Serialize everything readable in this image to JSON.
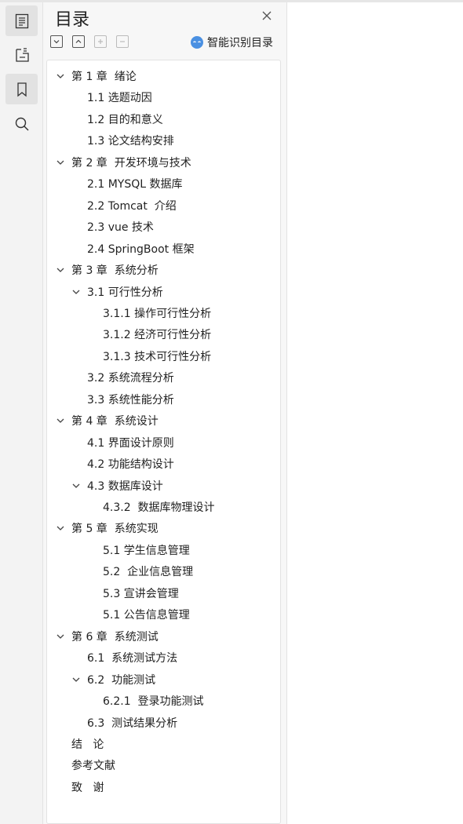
{
  "panel": {
    "title": "目录",
    "smart_label": "智能识别目录",
    "toolbar": [
      "collapse-all-icon",
      "expand-all-icon",
      "expand-level-icon",
      "collapse-level-icon"
    ]
  },
  "rail": [
    "toc-icon",
    "annotation-icon",
    "bookmark-icon",
    "search-icon"
  ],
  "toc": [
    {
      "text": "第 1 章  绪论",
      "level": 0,
      "expanded": true
    },
    {
      "text": "1.1 选题动因",
      "level": 1
    },
    {
      "text": "1.2 目的和意义",
      "level": 1
    },
    {
      "text": "1.3 论文结构安排",
      "level": 1
    },
    {
      "text": "第 2 章  开发环境与技术",
      "level": 0,
      "expanded": true
    },
    {
      "text": "2.1 MYSQL 数据库",
      "level": 1
    },
    {
      "text": "2.2 Tomcat  介绍",
      "level": 1
    },
    {
      "text": "2.3 vue 技术",
      "level": 1
    },
    {
      "text": "2.4 SpringBoot 框架",
      "level": 1
    },
    {
      "text": "第 3 章  系统分析",
      "level": 0,
      "expanded": true
    },
    {
      "text": "3.1 可行性分析",
      "level": 1,
      "expanded": true
    },
    {
      "text": "3.1.1 操作可行性分析",
      "level": 2
    },
    {
      "text": "3.1.2 经济可行性分析",
      "level": 2
    },
    {
      "text": "3.1.3 技术可行性分析",
      "level": 2
    },
    {
      "text": "3.2 系统流程分析",
      "level": 1
    },
    {
      "text": "3.3 系统性能分析",
      "level": 1
    },
    {
      "text": "第 4 章  系统设计",
      "level": 0,
      "expanded": true
    },
    {
      "text": "4.1 界面设计原则",
      "level": 1
    },
    {
      "text": "4.2 功能结构设计",
      "level": 1
    },
    {
      "text": "4.3 数据库设计",
      "level": 1,
      "expanded": true
    },
    {
      "text": "4.3.2  数据库物理设计",
      "level": 2
    },
    {
      "text": "第 5 章  系统实现",
      "level": 0,
      "expanded": true
    },
    {
      "text": "5.1 学生信息管理",
      "level": 2
    },
    {
      "text": "5.2  企业信息管理",
      "level": 2
    },
    {
      "text": "5.3 宣讲会管理",
      "level": 2
    },
    {
      "text": "5.1 公告信息管理",
      "level": 2
    },
    {
      "text": "第 6 章  系统测试",
      "level": 0,
      "expanded": true
    },
    {
      "text": "6.1  系统测试方法",
      "level": 1
    },
    {
      "text": "6.2  功能测试",
      "level": 1,
      "expanded": true
    },
    {
      "text": "6.2.1  登录功能测试",
      "level": 2
    },
    {
      "text": "6.3  测试结果分析",
      "level": 1
    },
    {
      "text": "结   论",
      "level": 0
    },
    {
      "text": "参考文献",
      "level": 0
    },
    {
      "text": "致   谢",
      "level": 0
    }
  ],
  "colors": {
    "accent": "#4a90e2",
    "text": "#222222"
  }
}
